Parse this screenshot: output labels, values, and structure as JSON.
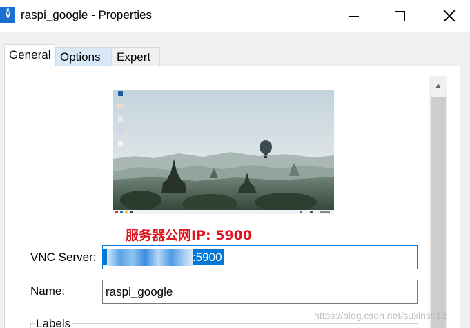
{
  "window": {
    "app_icon_text": "Vͨ",
    "title": "raspi_google - Properties",
    "icons": {
      "minimize": "minimize-icon",
      "maximize": "maximize-icon",
      "close": "close-icon"
    }
  },
  "tabs": [
    {
      "label": "General",
      "selected": true
    },
    {
      "label": "Options",
      "selected": false
    },
    {
      "label": "Expert",
      "selected": false
    }
  ],
  "preview": {
    "description_icon": "desktop-preview-image"
  },
  "annotation": {
    "text": "服务器公网IP: 5900",
    "color": "#e0141e"
  },
  "form": {
    "vnc_server_label": "VNC Server:",
    "vnc_server_value": ":5900",
    "name_label": "Name:",
    "name_value": "raspi_google",
    "labels_group_title": "Labels"
  },
  "watermark": "https://blog.csdn.net/suxinsu12",
  "colors": {
    "selection": "#0078d7",
    "tab_hover": "#d9e9f7",
    "app_icon": "#1b6fd1"
  }
}
